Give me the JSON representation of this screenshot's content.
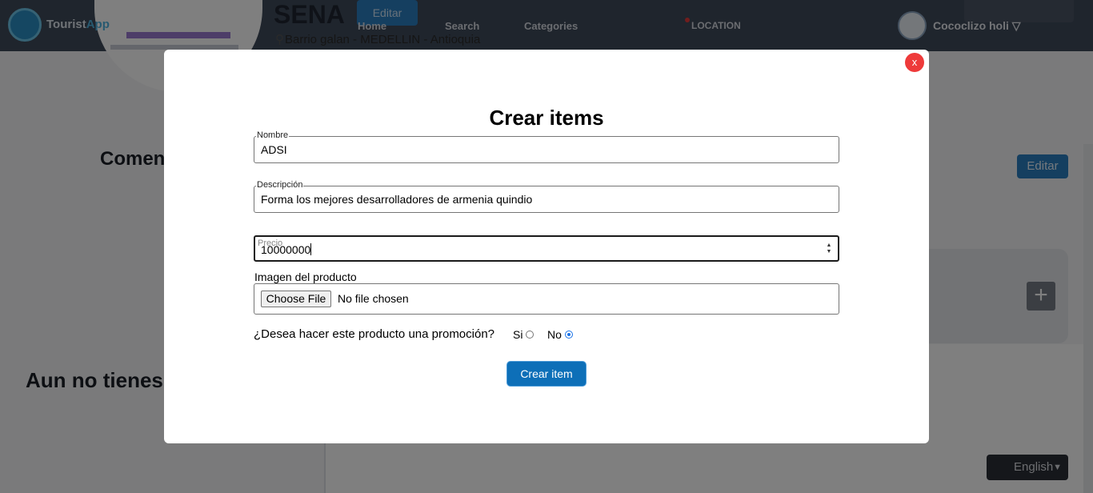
{
  "app": {
    "logo_text_main": "Tourist",
    "logo_text_accent": "App",
    "accent_color": "#2a8fc4"
  },
  "nav": {
    "home": "Home",
    "search": "Search",
    "categories": "Categories",
    "location": "LOCATION",
    "user_name": "Cococlizo holi",
    "user_menu_icon": "chevron-down-icon"
  },
  "company": {
    "name": "SENA",
    "edit_label": "Editar",
    "address": "Barrio galan - MEDELLIN - Antioquia"
  },
  "background": {
    "heading_comments": "Comen",
    "edit_label": "Editar",
    "add_icon": "+",
    "heading_empty": "Aun no tienes",
    "language": "English"
  },
  "modal": {
    "close_label": "x",
    "title": "Crear items",
    "fields": {
      "nombre_label": "Nombre",
      "nombre_value": "ADSI",
      "descripcion_label": "Descripción",
      "descripcion_value": "Forma los mejores desarrolladores de armenia quindio",
      "precio_label": "Precio",
      "precio_value": "10000000"
    },
    "image": {
      "label": "Imagen del producto",
      "button": "Choose File",
      "status": "No file chosen"
    },
    "promo": {
      "question": "¿Desea hacer este producto una promoción?",
      "option_si": "Si",
      "option_no": "No",
      "selected": "No"
    },
    "submit_label": "Crear item",
    "close_color": "#ee3a3a",
    "submit_color": "#0d6fb8"
  }
}
